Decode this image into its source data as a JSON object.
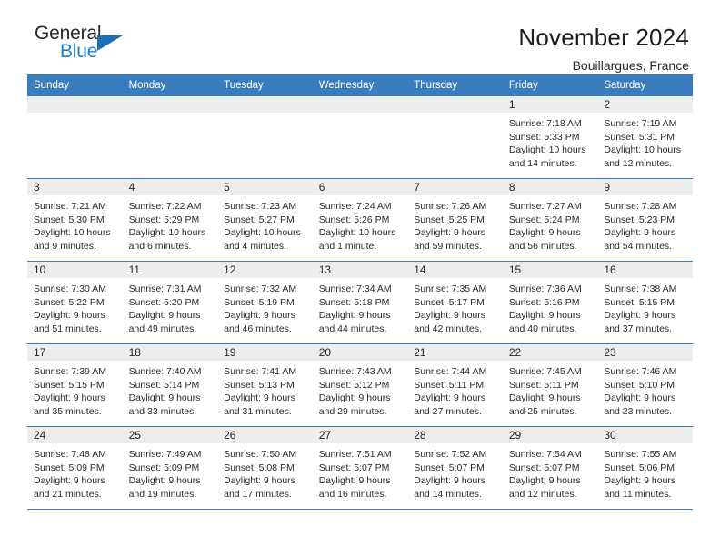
{
  "logo": {
    "word1": "General",
    "word2": "Blue",
    "triangle_color": "#1a6fb5",
    "blue_text_color": "#1f7ec4"
  },
  "header": {
    "title": "November 2024",
    "location": "Bouillargues, France"
  },
  "theme": {
    "header_blue": "#3a7dbf",
    "daynum_gray": "#eceded"
  },
  "calendar": {
    "weekday_headers": [
      "Sunday",
      "Monday",
      "Tuesday",
      "Wednesday",
      "Thursday",
      "Friday",
      "Saturday"
    ],
    "weeks": [
      [
        {
          "day": "",
          "sunrise": "",
          "sunset": "",
          "daylight1": "",
          "daylight2": ""
        },
        {
          "day": "",
          "sunrise": "",
          "sunset": "",
          "daylight1": "",
          "daylight2": ""
        },
        {
          "day": "",
          "sunrise": "",
          "sunset": "",
          "daylight1": "",
          "daylight2": ""
        },
        {
          "day": "",
          "sunrise": "",
          "sunset": "",
          "daylight1": "",
          "daylight2": ""
        },
        {
          "day": "",
          "sunrise": "",
          "sunset": "",
          "daylight1": "",
          "daylight2": ""
        },
        {
          "day": "1",
          "sunrise": "Sunrise: 7:18 AM",
          "sunset": "Sunset: 5:33 PM",
          "daylight1": "Daylight: 10 hours",
          "daylight2": "and 14 minutes."
        },
        {
          "day": "2",
          "sunrise": "Sunrise: 7:19 AM",
          "sunset": "Sunset: 5:31 PM",
          "daylight1": "Daylight: 10 hours",
          "daylight2": "and 12 minutes."
        }
      ],
      [
        {
          "day": "3",
          "sunrise": "Sunrise: 7:21 AM",
          "sunset": "Sunset: 5:30 PM",
          "daylight1": "Daylight: 10 hours",
          "daylight2": "and 9 minutes."
        },
        {
          "day": "4",
          "sunrise": "Sunrise: 7:22 AM",
          "sunset": "Sunset: 5:29 PM",
          "daylight1": "Daylight: 10 hours",
          "daylight2": "and 6 minutes."
        },
        {
          "day": "5",
          "sunrise": "Sunrise: 7:23 AM",
          "sunset": "Sunset: 5:27 PM",
          "daylight1": "Daylight: 10 hours",
          "daylight2": "and 4 minutes."
        },
        {
          "day": "6",
          "sunrise": "Sunrise: 7:24 AM",
          "sunset": "Sunset: 5:26 PM",
          "daylight1": "Daylight: 10 hours",
          "daylight2": "and 1 minute."
        },
        {
          "day": "7",
          "sunrise": "Sunrise: 7:26 AM",
          "sunset": "Sunset: 5:25 PM",
          "daylight1": "Daylight: 9 hours",
          "daylight2": "and 59 minutes."
        },
        {
          "day": "8",
          "sunrise": "Sunrise: 7:27 AM",
          "sunset": "Sunset: 5:24 PM",
          "daylight1": "Daylight: 9 hours",
          "daylight2": "and 56 minutes."
        },
        {
          "day": "9",
          "sunrise": "Sunrise: 7:28 AM",
          "sunset": "Sunset: 5:23 PM",
          "daylight1": "Daylight: 9 hours",
          "daylight2": "and 54 minutes."
        }
      ],
      [
        {
          "day": "10",
          "sunrise": "Sunrise: 7:30 AM",
          "sunset": "Sunset: 5:22 PM",
          "daylight1": "Daylight: 9 hours",
          "daylight2": "and 51 minutes."
        },
        {
          "day": "11",
          "sunrise": "Sunrise: 7:31 AM",
          "sunset": "Sunset: 5:20 PM",
          "daylight1": "Daylight: 9 hours",
          "daylight2": "and 49 minutes."
        },
        {
          "day": "12",
          "sunrise": "Sunrise: 7:32 AM",
          "sunset": "Sunset: 5:19 PM",
          "daylight1": "Daylight: 9 hours",
          "daylight2": "and 46 minutes."
        },
        {
          "day": "13",
          "sunrise": "Sunrise: 7:34 AM",
          "sunset": "Sunset: 5:18 PM",
          "daylight1": "Daylight: 9 hours",
          "daylight2": "and 44 minutes."
        },
        {
          "day": "14",
          "sunrise": "Sunrise: 7:35 AM",
          "sunset": "Sunset: 5:17 PM",
          "daylight1": "Daylight: 9 hours",
          "daylight2": "and 42 minutes."
        },
        {
          "day": "15",
          "sunrise": "Sunrise: 7:36 AM",
          "sunset": "Sunset: 5:16 PM",
          "daylight1": "Daylight: 9 hours",
          "daylight2": "and 40 minutes."
        },
        {
          "day": "16",
          "sunrise": "Sunrise: 7:38 AM",
          "sunset": "Sunset: 5:15 PM",
          "daylight1": "Daylight: 9 hours",
          "daylight2": "and 37 minutes."
        }
      ],
      [
        {
          "day": "17",
          "sunrise": "Sunrise: 7:39 AM",
          "sunset": "Sunset: 5:15 PM",
          "daylight1": "Daylight: 9 hours",
          "daylight2": "and 35 minutes."
        },
        {
          "day": "18",
          "sunrise": "Sunrise: 7:40 AM",
          "sunset": "Sunset: 5:14 PM",
          "daylight1": "Daylight: 9 hours",
          "daylight2": "and 33 minutes."
        },
        {
          "day": "19",
          "sunrise": "Sunrise: 7:41 AM",
          "sunset": "Sunset: 5:13 PM",
          "daylight1": "Daylight: 9 hours",
          "daylight2": "and 31 minutes."
        },
        {
          "day": "20",
          "sunrise": "Sunrise: 7:43 AM",
          "sunset": "Sunset: 5:12 PM",
          "daylight1": "Daylight: 9 hours",
          "daylight2": "and 29 minutes."
        },
        {
          "day": "21",
          "sunrise": "Sunrise: 7:44 AM",
          "sunset": "Sunset: 5:11 PM",
          "daylight1": "Daylight: 9 hours",
          "daylight2": "and 27 minutes."
        },
        {
          "day": "22",
          "sunrise": "Sunrise: 7:45 AM",
          "sunset": "Sunset: 5:11 PM",
          "daylight1": "Daylight: 9 hours",
          "daylight2": "and 25 minutes."
        },
        {
          "day": "23",
          "sunrise": "Sunrise: 7:46 AM",
          "sunset": "Sunset: 5:10 PM",
          "daylight1": "Daylight: 9 hours",
          "daylight2": "and 23 minutes."
        }
      ],
      [
        {
          "day": "24",
          "sunrise": "Sunrise: 7:48 AM",
          "sunset": "Sunset: 5:09 PM",
          "daylight1": "Daylight: 9 hours",
          "daylight2": "and 21 minutes."
        },
        {
          "day": "25",
          "sunrise": "Sunrise: 7:49 AM",
          "sunset": "Sunset: 5:09 PM",
          "daylight1": "Daylight: 9 hours",
          "daylight2": "and 19 minutes."
        },
        {
          "day": "26",
          "sunrise": "Sunrise: 7:50 AM",
          "sunset": "Sunset: 5:08 PM",
          "daylight1": "Daylight: 9 hours",
          "daylight2": "and 17 minutes."
        },
        {
          "day": "27",
          "sunrise": "Sunrise: 7:51 AM",
          "sunset": "Sunset: 5:07 PM",
          "daylight1": "Daylight: 9 hours",
          "daylight2": "and 16 minutes."
        },
        {
          "day": "28",
          "sunrise": "Sunrise: 7:52 AM",
          "sunset": "Sunset: 5:07 PM",
          "daylight1": "Daylight: 9 hours",
          "daylight2": "and 14 minutes."
        },
        {
          "day": "29",
          "sunrise": "Sunrise: 7:54 AM",
          "sunset": "Sunset: 5:07 PM",
          "daylight1": "Daylight: 9 hours",
          "daylight2": "and 12 minutes."
        },
        {
          "day": "30",
          "sunrise": "Sunrise: 7:55 AM",
          "sunset": "Sunset: 5:06 PM",
          "daylight1": "Daylight: 9 hours",
          "daylight2": "and 11 minutes."
        }
      ]
    ]
  }
}
